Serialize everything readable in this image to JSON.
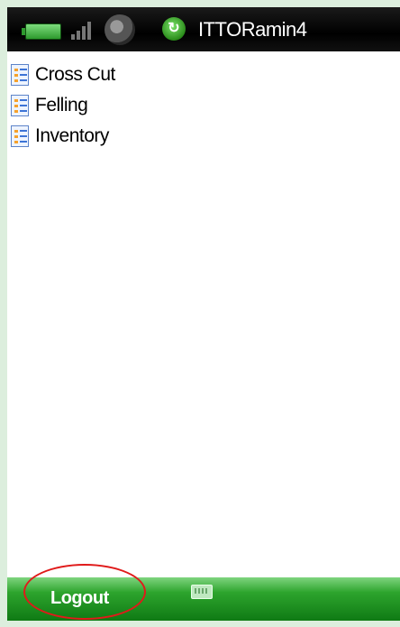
{
  "status_bar": {
    "title": "ITTORamin4",
    "icons": [
      "battery-icon",
      "signal-icon",
      "speaker-icon",
      "sync-icon"
    ]
  },
  "list": {
    "items": [
      {
        "label": "Cross Cut",
        "icon": "list-icon"
      },
      {
        "label": "Felling",
        "icon": "list-icon"
      },
      {
        "label": "Inventory",
        "icon": "list-icon"
      }
    ]
  },
  "soft_bar": {
    "left_label": "Logout",
    "center_icon": "keyboard-icon"
  },
  "colors": {
    "page_background": "#dceedd",
    "status_bar": "#000000",
    "soft_bar_accent": "#2da42d",
    "annotation_circle": "#e01a1a"
  }
}
